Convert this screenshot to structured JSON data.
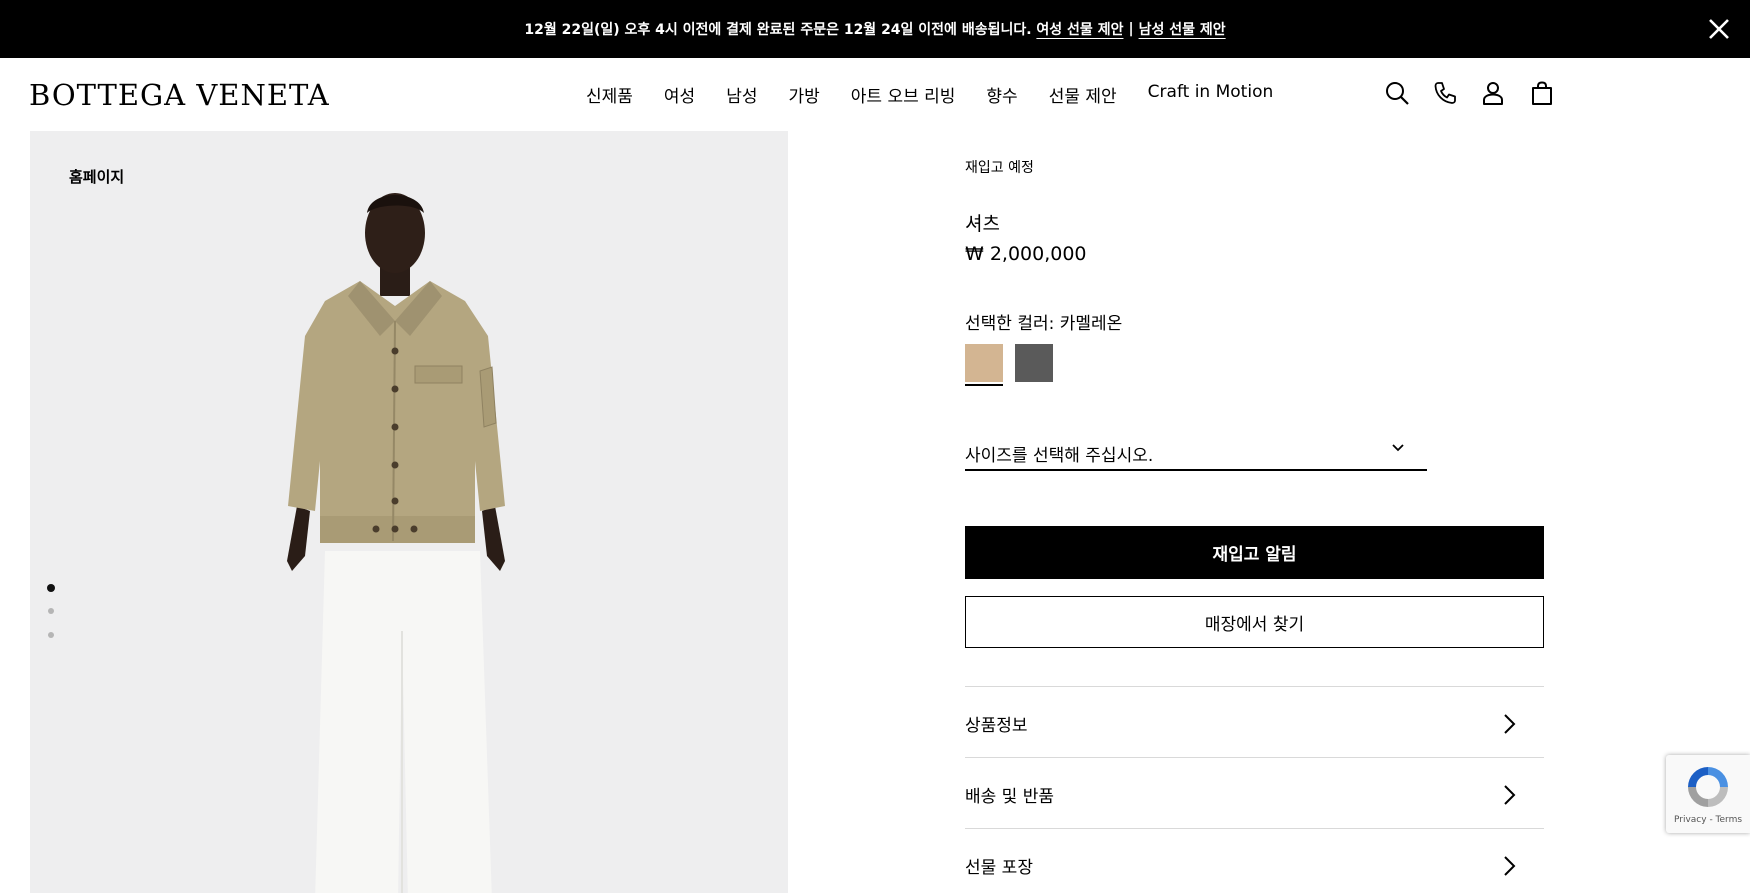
{
  "announcement": {
    "text": "12월 22일(일) 오후 4시 이전에 결제 완료된 주문은 12월 24일 이전에 배송됩니다.",
    "link_women": "여성 선물 제안",
    "separator": "|",
    "link_men": "남성 선물 제안",
    "close_icon": "close-icon"
  },
  "header": {
    "logo": "BOTTEGA VENETA",
    "nav": [
      "신제품",
      "여성",
      "남성",
      "가방",
      "아트 오브 리빙",
      "향수",
      "선물 제안",
      "Craft in Motion"
    ],
    "icons": [
      "search-icon",
      "phone-icon",
      "account-icon",
      "bag-icon"
    ]
  },
  "gallery": {
    "breadcrumb": "홈페이지",
    "slides_total": 3,
    "active_slide": 1
  },
  "product": {
    "status": "재입고 예정",
    "name": "셔츠",
    "price": "₩ 2,000,000",
    "color_label": "선택한 컬러: 카멜레온",
    "swatches": [
      {
        "color": "#d3b592",
        "selected": true
      },
      {
        "color": "#5a5a5a",
        "selected": false
      }
    ],
    "size_placeholder": "사이즈를 선택해 주십시오.",
    "primary_button": "재입고 알림",
    "secondary_button": "매장에서 찾기",
    "accordions": [
      "상품정보",
      "배송 및 반품",
      "선물 포장"
    ]
  },
  "recaptcha": {
    "text": "Privacy - Terms"
  }
}
